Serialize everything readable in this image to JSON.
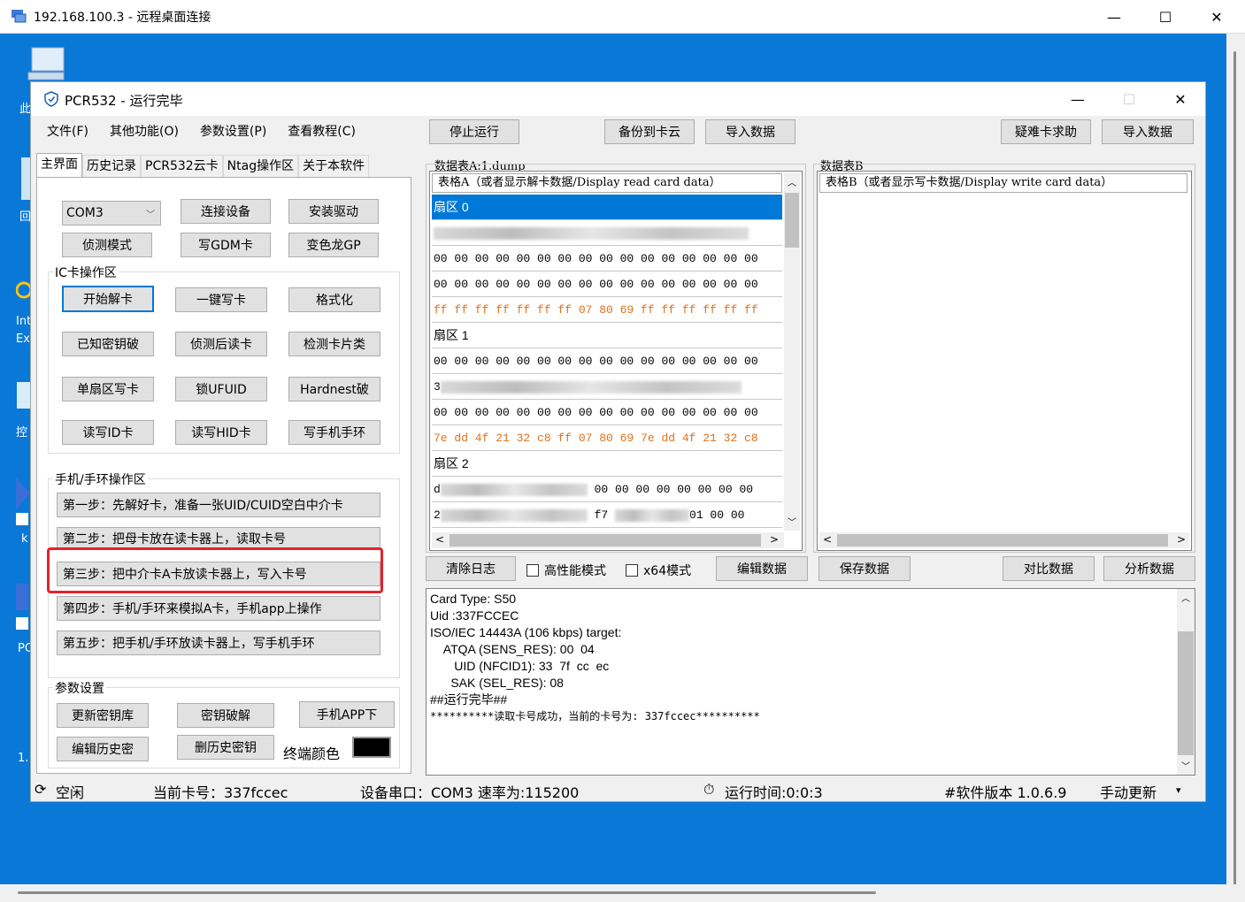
{
  "rdp": {
    "title": "192.168.100.3 - 远程桌面连接",
    "min": "—",
    "max": "☐",
    "close": "✕"
  },
  "desktop": {
    "icons": [
      "此",
      "回",
      "Int",
      "Ex",
      "控",
      "k",
      "PC",
      "1."
    ]
  },
  "app": {
    "title": "PCR532 - 运行完毕",
    "min": "—",
    "max": "☐",
    "close": "✕"
  },
  "menu": [
    "文件(F)",
    "其他功能(O)",
    "参数设置(P)",
    "查看教程(C)"
  ],
  "toolbar": {
    "stop": "停止运行",
    "backup": "备份到卡云",
    "import1": "导入数据",
    "help": "疑难卡求助",
    "import2": "导入数据"
  },
  "tabs": [
    "主界面",
    "历史记录",
    "PCR532云卡",
    "Ntag操作区",
    "关于本软件"
  ],
  "top_controls": {
    "com_value": "COM3",
    "connect": "连接设备",
    "install": "安装驱动",
    "detect": "侦测模式",
    "write_gdm": "写GDM卡",
    "chameleon": "变色龙GP"
  },
  "ic_group": {
    "label": "IC卡操作区",
    "buttons": [
      "开始解卡",
      "一键写卡",
      "格式化",
      "已知密钥破",
      "侦测后读卡",
      "检测卡片类",
      "单扇区写卡",
      "锁UFUID",
      "Hardnest破",
      "读写ID卡",
      "读写HID卡",
      "写手机手环"
    ]
  },
  "phone_group": {
    "label": "手机/手环操作区",
    "steps": [
      "第一步：先解好卡，准备一张UID/CUID空白中介卡",
      "第二步：把母卡放在读卡器上，读取卡号",
      "第三步：把中介卡A卡放读卡器上，写入卡号",
      "第四步：手机/手环来模拟A卡，手机app上操作",
      "第五步：把手机/手环放读卡器上，写手机手环"
    ]
  },
  "param_group": {
    "label": "参数设置",
    "update_keys": "更新密钥库",
    "key_crack": "密钥破解",
    "phone_app": "手机APP下",
    "edit_history": "编辑历史密",
    "delete_history": "删历史密钥",
    "terminal_color_label": "终端颜色",
    "terminal_color": "#000000"
  },
  "tableA": {
    "label": "数据表A:1.dump",
    "header": "表格A（或者显示解卡数据/Display read card data）",
    "rows": [
      {
        "type": "sector",
        "text": "扇区 0",
        "selected": true
      },
      {
        "type": "blur",
        "text": ""
      },
      {
        "type": "data",
        "text": "00 00 00 00 00 00 00 00 00 00 00 00 00 00 00 00"
      },
      {
        "type": "data",
        "text": "00 00 00 00 00 00 00 00 00 00 00 00 00 00 00 00"
      },
      {
        "type": "orange",
        "text": "ff ff ff ff ff ff ff 07 80 69 ff ff ff ff ff ff"
      },
      {
        "type": "sector",
        "text": "扇区 1"
      },
      {
        "type": "data",
        "text": "00 00 00 00 00 00 00 00 00 00 00 00 00 00 00 00"
      },
      {
        "type": "blurp",
        "text": "3"
      },
      {
        "type": "data",
        "text": "00 00 00 00 00 00 00 00 00 00 00 00 00 00 00 00"
      },
      {
        "type": "orange",
        "text": "7e dd 4f 21 32 c8 ff 07 80 69 7e dd 4f 21 32 c8"
      },
      {
        "type": "sector",
        "text": "扇区 2"
      },
      {
        "type": "blurs",
        "text": "d",
        "suffix": "00 00 00 00 00 00 00 00"
      },
      {
        "type": "blurm",
        "text": "2",
        "mid": "f7",
        "suffix": "01 00 00"
      }
    ]
  },
  "tableB": {
    "label": "数据表B",
    "header": "表格B（或者显示写卡数据/Display write card data）"
  },
  "bottom_controls": {
    "clear_log": "清除日志",
    "high_perf": "高性能模式",
    "x64": "x64模式",
    "edit_data": "编辑数据",
    "save_data": "保存数据",
    "compare": "对比数据",
    "analyze": "分析数据"
  },
  "log": [
    "Card Type: S50",
    "Uid :337FCCEC",
    "ISO/IEC 14443A (106 kbps) target:",
    "    ATQA (SENS_RES): 00  04",
    "       UID (NFCID1): 33  7f  cc  ec",
    "      SAK (SEL_RES): 08",
    "##运行完毕##",
    "**********读取卡号成功，当前的卡号为: 337fccec**********"
  ],
  "status": {
    "idle": "空闲",
    "card": "当前卡号：337fccec",
    "port": "设备串口：COM3 速率为:115200",
    "runtime": "运行时间:0:0:3",
    "version": "#软件版本 1.0.6.9",
    "update": "手动更新"
  }
}
